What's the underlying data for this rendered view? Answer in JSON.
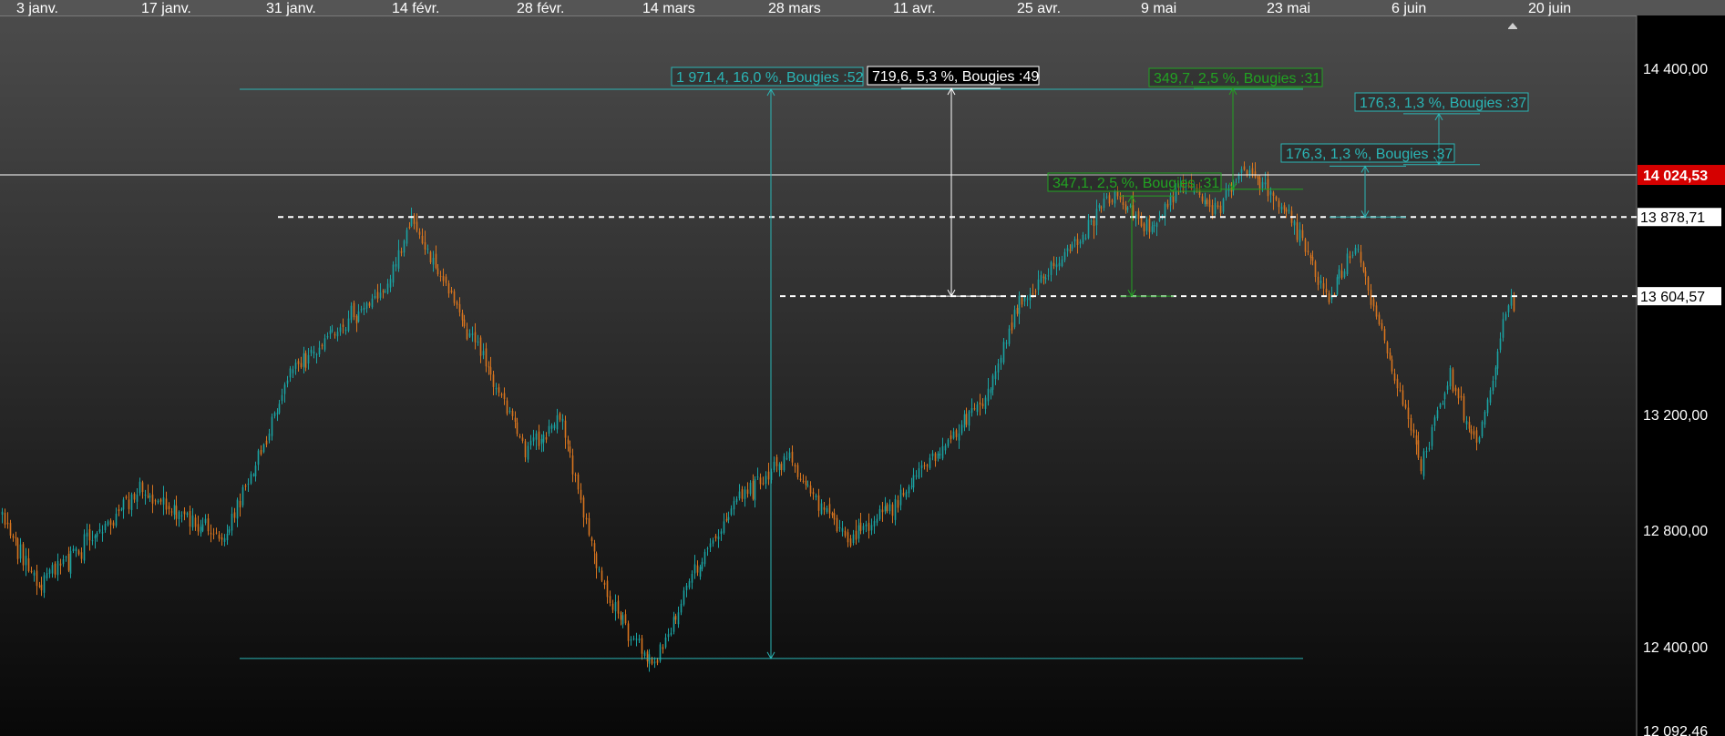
{
  "x_axis": {
    "labels": [
      "3 janv.",
      "17 janv.",
      "31 janv.",
      "14 févr.",
      "28 févr.",
      "14 mars",
      "28 mars",
      "11 avr.",
      "25 avr.",
      "9 mai",
      "23 mai",
      "6 juin",
      "20 juin"
    ]
  },
  "y_axis": {
    "tick_labels": [
      "14 400,00",
      "13 200,00",
      "12 800,00",
      "12 400,00",
      "12 092,46"
    ],
    "min": 12000,
    "max": 14600
  },
  "price": {
    "current": 14024.53,
    "current_label": "14 024,53",
    "dashed_levels": [
      {
        "value": 13878.71,
        "label": "13 878,71"
      },
      {
        "value": 13604.57,
        "label": "13 604,57"
      }
    ]
  },
  "annotations": [
    {
      "text": "1 971,4, 16,0 %, Bougies :52",
      "color": "#2bb5b5",
      "from": 12350,
      "to": 14321
    },
    {
      "text": "719,6, 5,3 %, Bougies :49",
      "color": "#ffffff",
      "from": 13604.6,
      "to": 14324.2
    },
    {
      "text": "349,7, 2,5 %, Bougies :31",
      "color": "#22a322",
      "from": 13975,
      "to": 14324.7
    },
    {
      "text": "347,1, 2,5 %, Bougies :31",
      "color": "#22a322",
      "from": 13604.6,
      "to": 13951.7
    },
    {
      "text": "176,3, 1,3 %, Bougies :37",
      "color": "#2bb5b5",
      "from": 14060,
      "to": 14236.3
    },
    {
      "text": "176,3, 1,3 %, Bougies :37",
      "color": "#2bb5b5",
      "from": 13878.7,
      "to": 14055
    }
  ],
  "colors": {
    "up": "#1aa3a3",
    "down": "#d8751f",
    "last_price_bg": "#d50000",
    "axis_bg": "#000000",
    "header_bg": "#555555"
  },
  "chart_data": {
    "type": "candlestick",
    "x_range": [
      "2023-01-02",
      "2023-06-26"
    ],
    "ylim": [
      12000,
      14600
    ],
    "key_levels": [
      {
        "date": "2023-01-02",
        "value": 12850
      },
      {
        "date": "2023-01-06",
        "value": 12600
      },
      {
        "date": "2023-01-17",
        "value": 12930
      },
      {
        "date": "2023-01-26",
        "value": 12760
      },
      {
        "date": "2023-02-02",
        "value": 13330
      },
      {
        "date": "2023-02-07",
        "value": 13500
      },
      {
        "date": "2023-02-12",
        "value": 13620
      },
      {
        "date": "2023-02-15",
        "value": 13860
      },
      {
        "date": "2023-02-21",
        "value": 13500
      },
      {
        "date": "2023-02-27",
        "value": 13080
      },
      {
        "date": "2023-03-03",
        "value": 13170
      },
      {
        "date": "2023-03-07",
        "value": 12650
      },
      {
        "date": "2023-03-10",
        "value": 12450
      },
      {
        "date": "2023-03-13",
        "value": 12320
      },
      {
        "date": "2023-03-17",
        "value": 12640
      },
      {
        "date": "2023-03-22",
        "value": 12900
      },
      {
        "date": "2023-03-27",
        "value": 13050
      },
      {
        "date": "2023-04-03",
        "value": 12750
      },
      {
        "date": "2023-04-08",
        "value": 12900
      },
      {
        "date": "2023-04-12",
        "value": 13050
      },
      {
        "date": "2023-04-17",
        "value": 13230
      },
      {
        "date": "2023-04-21",
        "value": 13580
      },
      {
        "date": "2023-04-26",
        "value": 13760
      },
      {
        "date": "2023-05-01",
        "value": 13960
      },
      {
        "date": "2023-05-05",
        "value": 13830
      },
      {
        "date": "2023-05-09",
        "value": 14010
      },
      {
        "date": "2023-05-12",
        "value": 13900
      },
      {
        "date": "2023-05-15",
        "value": 14050
      },
      {
        "date": "2023-05-20",
        "value": 13880
      },
      {
        "date": "2023-05-24",
        "value": 13600
      },
      {
        "date": "2023-05-27",
        "value": 13780
      },
      {
        "date": "2023-05-31",
        "value": 13330
      },
      {
        "date": "2023-06-03",
        "value": 13030
      },
      {
        "date": "2023-06-06",
        "value": 13330
      },
      {
        "date": "2023-06-09",
        "value": 13080
      },
      {
        "date": "2023-06-12",
        "value": 13560
      },
      {
        "date": "2023-06-16",
        "value": 13680
      },
      {
        "date": "2023-06-20",
        "value": 13620
      },
      {
        "date": "2023-06-24",
        "value": 13480
      },
      {
        "date": "2023-06-28",
        "value": 13700
      },
      {
        "date": "2023-07-03",
        "value": 13640
      },
      {
        "date": "2023-07-06",
        "value": 13450
      },
      {
        "date": "2023-07-10",
        "value": 13850
      },
      {
        "date": "2023-07-14",
        "value": 14000
      },
      {
        "date": "2023-07-18",
        "value": 14120
      },
      {
        "date": "2023-07-20",
        "value": 13900
      },
      {
        "date": "2023-07-23",
        "value": 14200
      },
      {
        "date": "2023-07-26",
        "value": 14024.53
      }
    ]
  }
}
